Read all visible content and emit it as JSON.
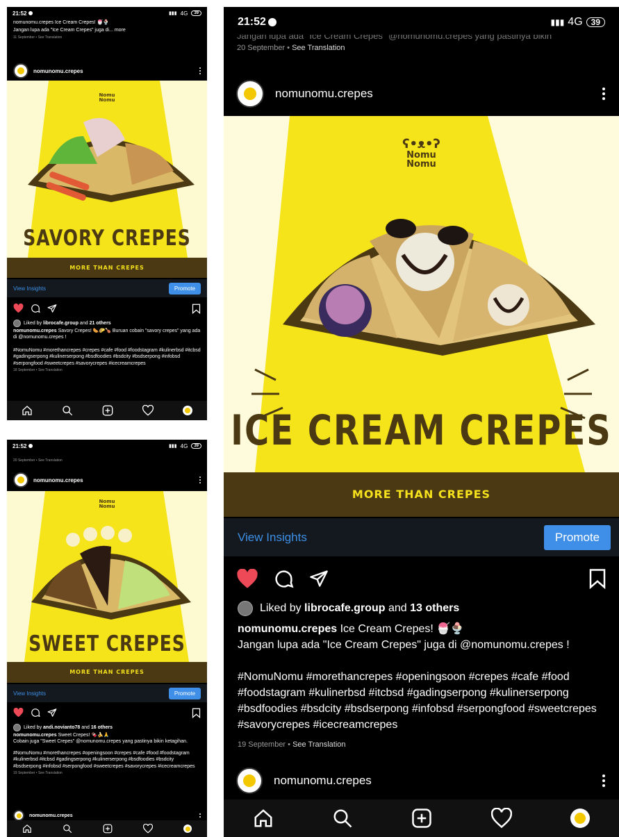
{
  "common": {
    "time": "21:52",
    "network": "4G",
    "battery": "39",
    "username": "nomunomu.crepes",
    "view_insights": "View Insights",
    "promote": "Promote",
    "see_translation": "See Translation",
    "logo_line1": "Nomu",
    "logo_line2": "Nomu",
    "banner": "MORE THAN CREPES",
    "icons": [
      "home-icon",
      "search-icon",
      "add-icon",
      "heart-icon",
      "profile-icon",
      "comment-icon",
      "share-icon",
      "bookmark-icon",
      "more-icon"
    ],
    "colors": {
      "accent": "#3f8fe8",
      "like": "#ed4956",
      "banner": "#4a3912",
      "image_bg": "#f6e41b"
    }
  },
  "post_savory": {
    "prev_caption": "nomunomu.crepes Ice Cream Crepes! 🍧🍨",
    "prev_caption2": "Jangan lupa ada \"Ice Cream Crepes\" juga di... more",
    "prev_date": "11 September",
    "title": "SAVORY CREPES",
    "liked_by_user": "librocafe.group",
    "liked_count": "21 others",
    "caption_user": "nomunomu.crepes",
    "caption_text": "Savory Crepes! 🌭🌮🍗 Buruan cobain \"savory crepes\" yang ada di @nomunomu.crepes !",
    "hashtags": "#NomuNomu #morethancrepes #crepes #cafe #food #foodstagram #kulinerbsd #itcbsd #gadingserpong #kulinerserpong #bsdfoodies #bsdcity #bsdserpong #infobsd #serpongfood #sweetcrepes #savorycrepes #icecreamcrepes",
    "date": "18 September"
  },
  "post_sweet": {
    "prev_date": "20 September",
    "title": "SWEET CREPES",
    "liked_by_user": "andi.novianto78",
    "liked_count": "16 others",
    "caption_user": "nomunomu.crepes",
    "caption_text": "Sweet Crepes! 🍫🍌🙏",
    "caption_text2": "Cobain juga \"Sweet Crepes\" @nomunomu.crepes yang pastinya bikin ketagihan.",
    "hashtags": "#NomuNomu #morethancrepes #openingsoon #crepes #cafe #food #foodstagram #kulinerbsd #itcbsd #gadingserpong #kulinerserpong #bsdfoodies #bsdcity #bsdserpong #infobsd #serpongfood #sweetcrepes #savorycrepes #icecreamcrepes",
    "date": "19 September",
    "next_username": "nomunomu.crepes"
  },
  "post_icecream": {
    "prev_caption": "Jangan lupa ada \"Ice Cream Crepes\" @nomunomu.crepes yang pastinya bikin",
    "prev_date": "20 September",
    "title": "ICE CREAM CREPES",
    "liked_by_user": "librocafe.group",
    "liked_count": "13 others",
    "caption_user": "nomunomu.crepes",
    "caption_text": "Ice Cream Crepes! 🍧🍨",
    "caption_text2": "Jangan lupa ada \"Ice Cream Crepes\" juga di @nomunomu.crepes !",
    "hashtags": "#NomuNomu #morethancrepes #openingsoon #crepes #cafe #food #foodstagram #kulinerbsd #itcbsd #gadingserpong #kulinerserpong #bsdfoodies #bsdcity #bsdserpong #infobsd #serpongfood #sweetcrepes #savorycrepes #icecreamcrepes",
    "date": "19 September",
    "next_username": "nomunomu.crepes"
  }
}
